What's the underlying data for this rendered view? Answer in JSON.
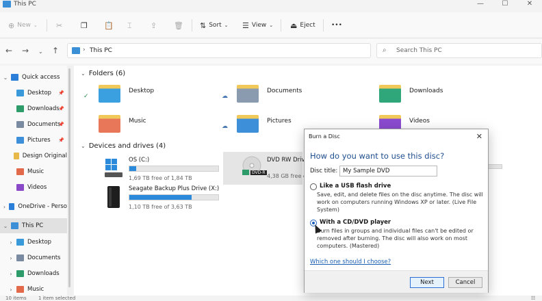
{
  "window": {
    "title": "This PC",
    "controls": [
      "—",
      "☐",
      "✕"
    ]
  },
  "toolbar": {
    "new_label": "New",
    "sort_label": "Sort",
    "view_label": "View",
    "eject_label": "Eject",
    "more_label": "•••"
  },
  "address": {
    "path": "This PC",
    "search_placeholder": "Search This PC"
  },
  "sidebar": {
    "items": [
      {
        "label": "Quick access",
        "arrow": "⌄",
        "icon": "star-icon",
        "color": "#2b7fd8"
      },
      {
        "label": "Desktop",
        "icon": "desktop-folder-icon",
        "color": "#3a9ad9",
        "pinned": "📌"
      },
      {
        "label": "Downloads",
        "icon": "downloads-icon",
        "color": "#2e9b6a",
        "pinned": "📌"
      },
      {
        "label": "Documents",
        "icon": "documents-icon",
        "color": "#7a8aa0",
        "pinned": "📌"
      },
      {
        "label": "Pictures",
        "icon": "pictures-icon",
        "color": "#3c8fd8",
        "pinned": "📌"
      },
      {
        "label": "Design Original",
        "icon": "folder-icon",
        "color": "#e8b84a"
      },
      {
        "label": "Music",
        "icon": "music-icon",
        "color": "#e26a4a"
      },
      {
        "label": "Videos",
        "icon": "videos-icon",
        "color": "#8a4ac8"
      },
      {
        "label": "OneDrive - Perso",
        "arrow": "›",
        "icon": "cloud-icon",
        "color": "#2b7fd8"
      },
      {
        "label": "This PC",
        "arrow": "⌄",
        "icon": "pc-icon",
        "color": "#3b8fd6"
      },
      {
        "label": "Desktop",
        "arrow": "›",
        "icon": "desktop-folder-icon",
        "color": "#3a9ad9"
      },
      {
        "label": "Documents",
        "arrow": "›",
        "icon": "documents-icon",
        "color": "#7a8aa0"
      },
      {
        "label": "Downloads",
        "arrow": "›",
        "icon": "downloads-icon",
        "color": "#2e9b6a"
      },
      {
        "label": "Music",
        "arrow": "›",
        "icon": "music-icon",
        "color": "#e26a4a"
      }
    ]
  },
  "main": {
    "folders_heading": "Folders (6)",
    "devices_heading": "Devices and drives (4)",
    "folders": [
      {
        "name": "Desktop",
        "sync": "✓",
        "color": "#3aa0e0"
      },
      {
        "name": "Documents",
        "sync": "☁",
        "color": "#8a9bb0"
      },
      {
        "name": "Downloads",
        "sync": "",
        "color": "#2fa77a"
      },
      {
        "name": "Music",
        "sync": "",
        "color": "#e8775a"
      },
      {
        "name": "Pictures",
        "sync": "☁",
        "color": "#3c8fd8"
      },
      {
        "name": "Videos",
        "sync": "",
        "color": "#8b4bd0"
      }
    ],
    "drives": [
      {
        "name": "OS (C:)",
        "free": "1,69 TB free of 1,84 TB",
        "used_fraction": 0.08
      },
      {
        "name": "DVD RW Drive",
        "free": "4,38 GB free o",
        "used_fraction": 0.0
      },
      {
        "name": "Seagate Backup Plus Drive (X:)",
        "free": "1,10 TB free of 3,63 TB",
        "used_fraction": 0.7
      }
    ],
    "dvd_badge": "DVD-R"
  },
  "status": {
    "items": "10 items",
    "selected": "1 item selected"
  },
  "dialog": {
    "title": "Burn a Disc",
    "question": "How do you want to use this disc?",
    "disc_title_label": "Disc title:",
    "disc_title_value": "My Sample DVD",
    "option1_label": "Like a USB flash drive",
    "option1_desc": "Save, edit, and delete files on the disc anytime. The disc will work on computers running Windows XP or later. (Live File System)",
    "option2_label": "With a CD/DVD player",
    "option2_desc": "Burn files in groups and individual files can't be edited or removed after burning. The disc will also work on most computers. (Mastered)",
    "help_link": "Which one should I choose?",
    "next_label": "Next",
    "cancel_label": "Cancel",
    "selected_option": "option2"
  }
}
